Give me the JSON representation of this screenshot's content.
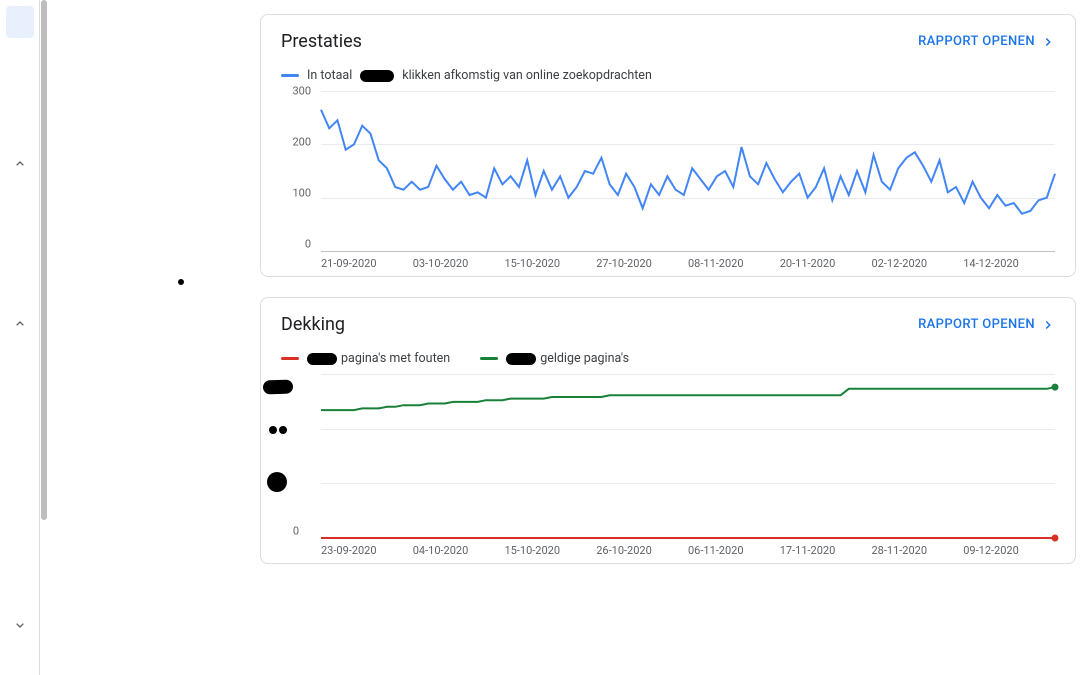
{
  "sidebar": {
    "chevrons": [
      "up",
      "up",
      "down"
    ]
  },
  "cards": {
    "prestaties": {
      "title": "Prestaties",
      "open_label": "RAPPORT OPENEN",
      "legend": {
        "series_label_prefix": "In totaal",
        "series_label_suffix": "klikken afkomstig van online zoekopdrachten",
        "color": "#4285f4"
      }
    },
    "dekking": {
      "title": "Dekking",
      "open_label": "RAPPORT OPENEN",
      "legend": {
        "errors_label": "pagina's met fouten",
        "valid_label": "geldige pagina's",
        "errors_color": "#d93025",
        "valid_color": "#188038"
      }
    }
  },
  "chart_data": [
    {
      "type": "line",
      "title": "Prestaties",
      "ylabel": "",
      "ylim": [
        0,
        300
      ],
      "yticks": [
        0,
        100,
        200,
        300
      ],
      "x_ticks": [
        "21-09-2020",
        "03-10-2020",
        "15-10-2020",
        "27-10-2020",
        "08-11-2020",
        "20-11-2020",
        "02-12-2020",
        "14-12-2020"
      ],
      "series": [
        {
          "name": "clicks",
          "color": "#4285f4",
          "values": [
            265,
            230,
            245,
            190,
            200,
            235,
            220,
            170,
            155,
            120,
            115,
            130,
            115,
            120,
            160,
            135,
            115,
            130,
            105,
            110,
            100,
            155,
            125,
            140,
            120,
            170,
            105,
            150,
            115,
            140,
            100,
            120,
            150,
            145,
            175,
            125,
            105,
            145,
            120,
            80,
            125,
            105,
            140,
            115,
            105,
            155,
            135,
            115,
            140,
            150,
            120,
            195,
            140,
            125,
            165,
            135,
            110,
            130,
            145,
            100,
            120,
            155,
            95,
            140,
            105,
            150,
            110,
            180,
            130,
            115,
            155,
            175,
            185,
            160,
            130,
            170,
            110,
            120,
            90,
            130,
            100,
            80,
            105,
            85,
            90,
            70,
            75,
            95,
            100,
            145
          ]
        }
      ]
    },
    {
      "type": "line",
      "title": "Dekking",
      "ylabel": "",
      "ylim": [
        0,
        100
      ],
      "yticks_redacted": true,
      "x_ticks": [
        "23-09-2020",
        "04-10-2020",
        "15-10-2020",
        "26-10-2020",
        "06-11-2020",
        "17-11-2020",
        "28-11-2020",
        "09-12-2020"
      ],
      "series": [
        {
          "name": "errors",
          "color": "#d93025",
          "values": [
            0,
            0,
            0,
            0,
            0,
            0,
            0,
            0,
            0,
            0,
            0,
            0,
            0,
            0,
            0,
            0,
            0,
            0,
            0,
            0,
            0,
            0,
            0,
            0,
            0,
            0,
            0,
            0,
            0,
            0,
            0,
            0,
            0,
            0,
            0,
            0,
            0,
            0,
            0,
            0,
            0,
            0,
            0,
            0,
            0,
            0,
            0,
            0,
            0,
            0,
            0,
            0,
            0,
            0,
            0,
            0,
            0,
            0,
            0,
            0,
            0,
            0,
            0,
            0,
            0,
            0,
            0,
            0,
            0,
            0,
            0,
            0,
            0,
            0,
            0,
            0,
            0,
            0,
            0,
            0,
            0,
            0,
            0,
            0,
            0,
            0,
            0,
            0,
            0,
            0
          ],
          "endpoint_marker": true
        },
        {
          "name": "valid",
          "color": "#188038",
          "values": [
            78,
            78,
            78,
            78,
            78,
            79,
            79,
            79,
            80,
            80,
            81,
            81,
            81,
            82,
            82,
            82,
            83,
            83,
            83,
            83,
            84,
            84,
            84,
            85,
            85,
            85,
            85,
            85,
            86,
            86,
            86,
            86,
            86,
            86,
            86,
            87,
            87,
            87,
            87,
            87,
            87,
            87,
            87,
            87,
            87,
            87,
            87,
            87,
            87,
            87,
            87,
            87,
            87,
            87,
            87,
            87,
            87,
            87,
            87,
            87,
            87,
            87,
            87,
            87,
            91,
            91,
            91,
            91,
            91,
            91,
            91,
            91,
            91,
            91,
            91,
            91,
            91,
            91,
            91,
            91,
            91,
            91,
            91,
            91,
            91,
            91,
            91,
            91,
            91,
            92
          ],
          "endpoint_marker": true
        }
      ]
    }
  ]
}
